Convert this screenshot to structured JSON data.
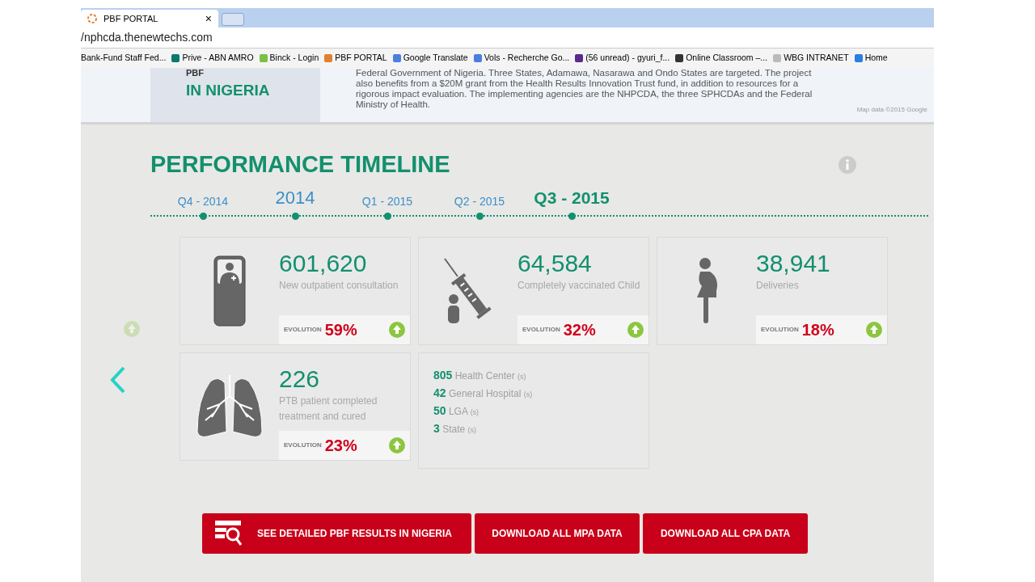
{
  "browser": {
    "tab": {
      "title": "PBF PORTAL",
      "close": "×"
    },
    "address": "/nphcda.thenewtechs.com",
    "bookmarks": [
      "Bank-Fund Staff Fed...",
      "Prive - ABN AMRO",
      "Binck - Login",
      "PBF PORTAL",
      "Google Translate",
      "Vols - Recherche Go...",
      "(56 unread) - gyuri_f...",
      "Online Classroom –...",
      "WBG INTRANET",
      "Home"
    ]
  },
  "intro": {
    "heading_top": "PBF",
    "heading": "IN NIGERIA",
    "text": "Federal Government of Nigeria. Three States, Adamawa, Nasarawa and Ondo States are targeted. The project also benefits from a $20M grant from the Health Results Innovation Trust fund, in addition to resources for a rigorous impact evaluation. The implementing agencies are the NHPCDA, the three SPHCDAs and the Federal Ministry of Health.",
    "map_credit": "Map data ©2015 Google"
  },
  "section_title": "PERFORMANCE TIMELINE",
  "timeline": [
    {
      "label": "Q4 - 2014",
      "kind": "quarter",
      "selected": false
    },
    {
      "label": "2014",
      "kind": "year",
      "selected": false
    },
    {
      "label": "Q1 - 2015",
      "kind": "quarter",
      "selected": false
    },
    {
      "label": "Q2 - 2015",
      "kind": "quarter",
      "selected": false
    },
    {
      "label": "Q3 - 2015",
      "kind": "quarter",
      "selected": true
    }
  ],
  "cards": [
    {
      "kind": "metric",
      "value": "601,620",
      "label": "New outpatient consultation",
      "evolution_label": "EVOLUTION",
      "evolution": "59%"
    },
    {
      "kind": "metric",
      "value": "64,584",
      "label": "Completely vaccinated Child",
      "evolution_label": "EVOLUTION",
      "evolution": "32%"
    },
    {
      "kind": "metric",
      "value": "38,941",
      "label": "Deliveries",
      "evolution_label": "EVOLUTION",
      "evolution": "18%"
    },
    {
      "kind": "metric",
      "value": "226",
      "label": "PTB patient completed treatment and cured",
      "evolution_label": "EVOLUTION",
      "evolution": "23%"
    },
    {
      "kind": "summary",
      "lines": [
        {
          "count": "805",
          "label": "Health Center",
          "suffix": "(s)"
        },
        {
          "count": "42",
          "label": "General Hospital",
          "suffix": "(s)"
        },
        {
          "count": "50",
          "label": "LGA",
          "suffix": "(s)"
        },
        {
          "count": "3",
          "label": "State",
          "suffix": "(s)"
        }
      ]
    }
  ],
  "buttons": [
    {
      "label": "SEE DETAILED PBF RESULTS IN NIGERIA",
      "kind": "report"
    },
    {
      "label": "DOWNLOAD ALL MPA DATA",
      "kind": "plain"
    },
    {
      "label": "DOWNLOAD ALL CPA DATA",
      "kind": "plain"
    }
  ]
}
